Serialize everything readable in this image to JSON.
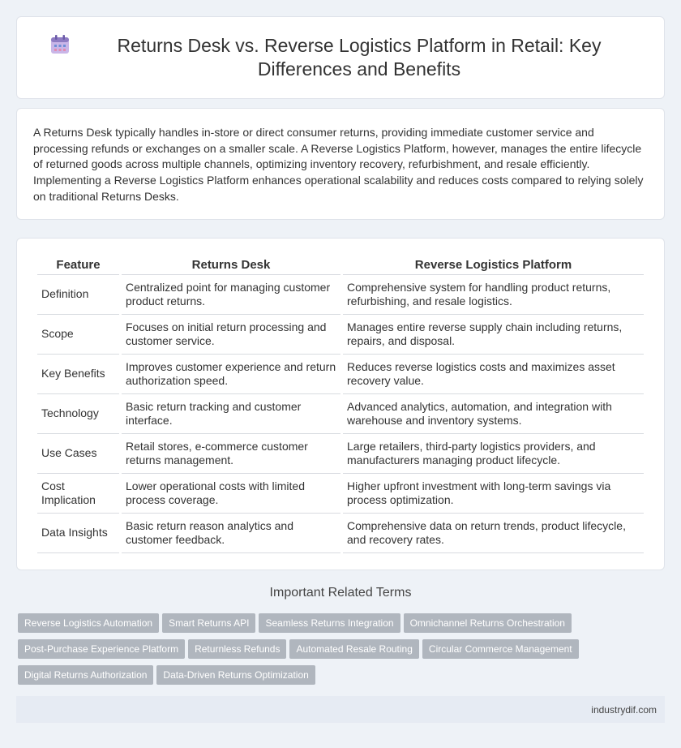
{
  "header": {
    "icon": "calendar-icon",
    "title": "Returns Desk vs. Reverse Logistics Platform in Retail: Key Differences and Benefits"
  },
  "intro": {
    "text": "A Returns Desk typically handles in-store or direct consumer returns, providing immediate customer service and processing refunds or exchanges on a smaller scale. A Reverse Logistics Platform, however, manages the entire lifecycle of returned goods across multiple channels, optimizing inventory recovery, refurbishment, and resale efficiently. Implementing a Reverse Logistics Platform enhances operational scalability and reduces costs compared to relying solely on traditional Returns Desks."
  },
  "table": {
    "headers": [
      "Feature",
      "Returns Desk",
      "Reverse Logistics Platform"
    ],
    "rows": [
      [
        "Definition",
        "Centralized point for managing customer product returns.",
        "Comprehensive system for handling product returns, refurbishing, and resale logistics."
      ],
      [
        "Scope",
        "Focuses on initial return processing and customer service.",
        "Manages entire reverse supply chain including returns, repairs, and disposal."
      ],
      [
        "Key Benefits",
        "Improves customer experience and return authorization speed.",
        "Reduces reverse logistics costs and maximizes asset recovery value."
      ],
      [
        "Technology",
        "Basic return tracking and customer interface.",
        "Advanced analytics, automation, and integration with warehouse and inventory systems."
      ],
      [
        "Use Cases",
        "Retail stores, e-commerce customer returns management.",
        "Large retailers, third-party logistics providers, and manufacturers managing product lifecycle."
      ],
      [
        "Cost Implication",
        "Lower operational costs with limited process coverage.",
        "Higher upfront investment with long-term savings via process optimization."
      ],
      [
        "Data Insights",
        "Basic return reason analytics and customer feedback.",
        "Comprehensive data on return trends, product lifecycle, and recovery rates."
      ]
    ]
  },
  "related": {
    "heading": "Important Related Terms",
    "tags": [
      "Reverse Logistics Automation",
      "Smart Returns API",
      "Seamless Returns Integration",
      "Omnichannel Returns Orchestration",
      "Post-Purchase Experience Platform",
      "Returnless Refunds",
      "Automated Resale Routing",
      "Circular Commerce Management",
      "Digital Returns Authorization",
      "Data-Driven Returns Optimization"
    ]
  },
  "footer": {
    "site": "industrydif.com"
  }
}
